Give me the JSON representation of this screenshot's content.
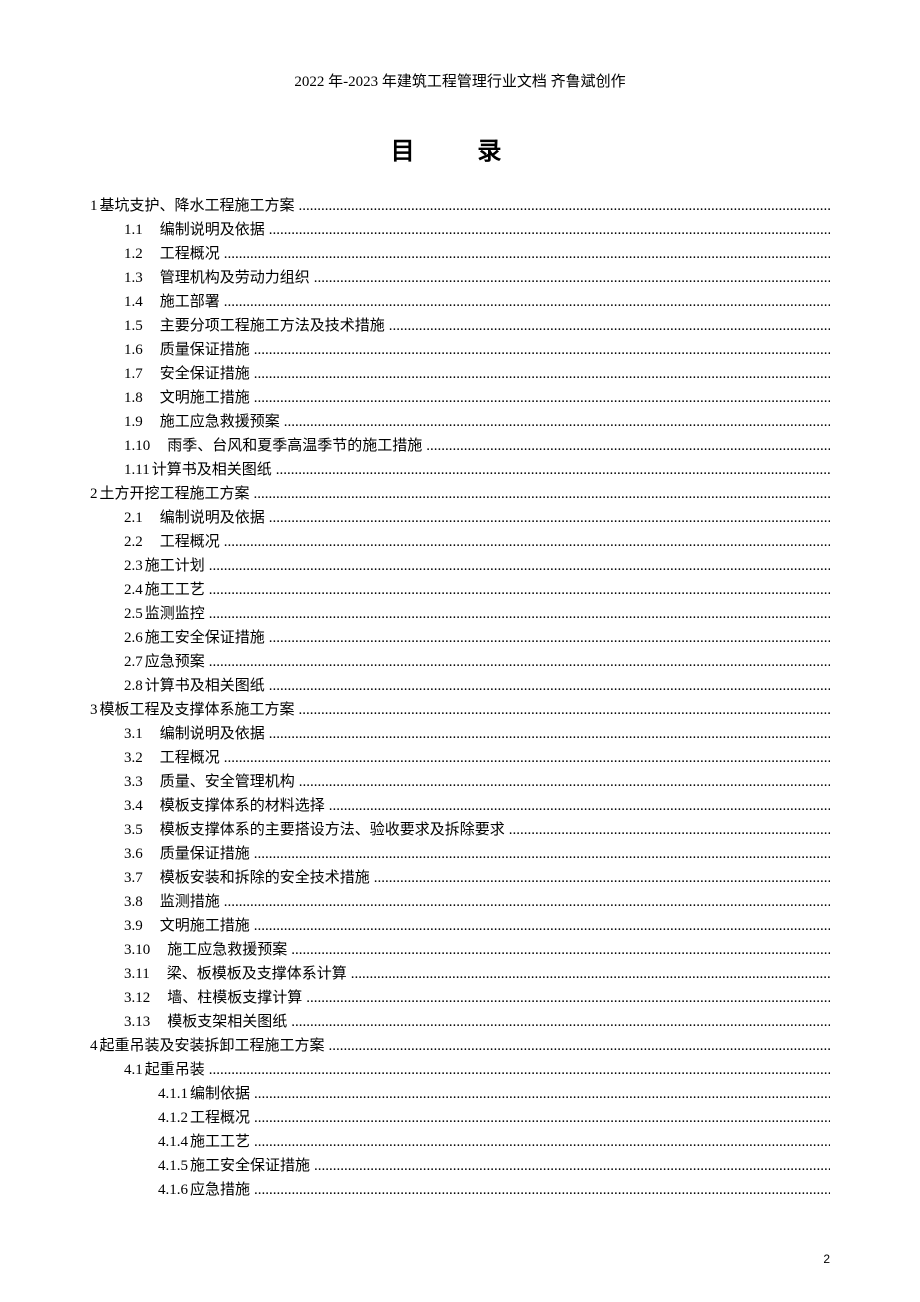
{
  "header": "2022 年-2023 年建筑工程管理行业文档 齐鲁斌创作",
  "title": "目 录",
  "page_number": "2",
  "toc": [
    {
      "indent": 0,
      "num": "1",
      "label": " 基坑支护、降水工程施工方案 "
    },
    {
      "indent": 1,
      "num": "1.1",
      "label": "　编制说明及依据 "
    },
    {
      "indent": 1,
      "num": "1.2",
      "label": "　工程概况 "
    },
    {
      "indent": 1,
      "num": "1.3",
      "label": "　管理机构及劳动力组织 "
    },
    {
      "indent": 1,
      "num": "1.4",
      "label": "　施工部署 "
    },
    {
      "indent": 1,
      "num": "1.5",
      "label": "　主要分项工程施工方法及技术措施"
    },
    {
      "indent": 1,
      "num": "1.6",
      "label": "　质量保证措施 "
    },
    {
      "indent": 1,
      "num": "1.7",
      "label": "　安全保证措施 "
    },
    {
      "indent": 1,
      "num": "1.8",
      "label": "　文明施工措施 "
    },
    {
      "indent": 1,
      "num": "1.9",
      "label": "　施工应急救援预案 "
    },
    {
      "indent": 1,
      "num": "1.10",
      "label": "　雨季、台风和夏季高温季节的施工措施"
    },
    {
      "indent": 1,
      "num": "1.11",
      "label": " 计算书及相关图纸 "
    },
    {
      "indent": 0,
      "num": "2",
      "label": " 土方开挖工程施工方案 "
    },
    {
      "indent": 1,
      "num": "2.1",
      "label": "　编制说明及依据 "
    },
    {
      "indent": 1,
      "num": "2.2",
      "label": "　工程概况 "
    },
    {
      "indent": 1,
      "num": "2.3",
      "label": " 施工计划 "
    },
    {
      "indent": 1,
      "num": "2.4",
      "label": " 施工工艺 "
    },
    {
      "indent": 1,
      "num": "2.5",
      "label": " 监测监控 "
    },
    {
      "indent": 1,
      "num": "2.6",
      "label": " 施工安全保证措施 "
    },
    {
      "indent": 1,
      "num": "2.7",
      "label": " 应急预案 "
    },
    {
      "indent": 1,
      "num": "2.8",
      "label": " 计算书及相关图纸 "
    },
    {
      "indent": 0,
      "num": "3",
      "label": " 模板工程及支撑体系施工方案 "
    },
    {
      "indent": 1,
      "num": "3.1",
      "label": "　编制说明及依据 "
    },
    {
      "indent": 1,
      "num": "3.2",
      "label": "　工程概况 "
    },
    {
      "indent": 1,
      "num": "3.3",
      "label": "　质量、安全管理机构 "
    },
    {
      "indent": 1,
      "num": "3.4",
      "label": "　模板支撑体系的材料选择"
    },
    {
      "indent": 1,
      "num": "3.5",
      "label": "　模板支撑体系的主要搭设方法、验收要求及拆除要求"
    },
    {
      "indent": 1,
      "num": "3.6",
      "label": "　质量保证措施 "
    },
    {
      "indent": 1,
      "num": "3.7",
      "label": "　模板安装和拆除的安全技术措施"
    },
    {
      "indent": 1,
      "num": "3.8",
      "label": "　监测措施 "
    },
    {
      "indent": 1,
      "num": "3.9",
      "label": "　文明施工措施 "
    },
    {
      "indent": 1,
      "num": "3.10",
      "label": "　施工应急救援预案 "
    },
    {
      "indent": 1,
      "num": "3.11",
      "label": "　梁、板模板及支撑体系计算"
    },
    {
      "indent": 1,
      "num": "3.12",
      "label": "　墙、柱模板支撑计算 "
    },
    {
      "indent": 1,
      "num": "3.13",
      "label": "　模板支架相关图纸 "
    },
    {
      "indent": 0,
      "num": "4",
      "label": " 起重吊装及安装拆卸工程施工方案"
    },
    {
      "indent": 1,
      "num": "4.1",
      "label": " 起重吊装 "
    },
    {
      "indent": 2,
      "num": "4.1.1",
      "label": " 编制依据 "
    },
    {
      "indent": 2,
      "num": "4.1.2",
      "label": " 工程概况 "
    },
    {
      "indent": 2,
      "num": "4.1.4",
      "label": " 施工工艺 "
    },
    {
      "indent": 2,
      "num": "4.1.5",
      "label": " 施工安全保证措施 "
    },
    {
      "indent": 2,
      "num": "4.1.6",
      "label": " 应急措施 "
    }
  ]
}
